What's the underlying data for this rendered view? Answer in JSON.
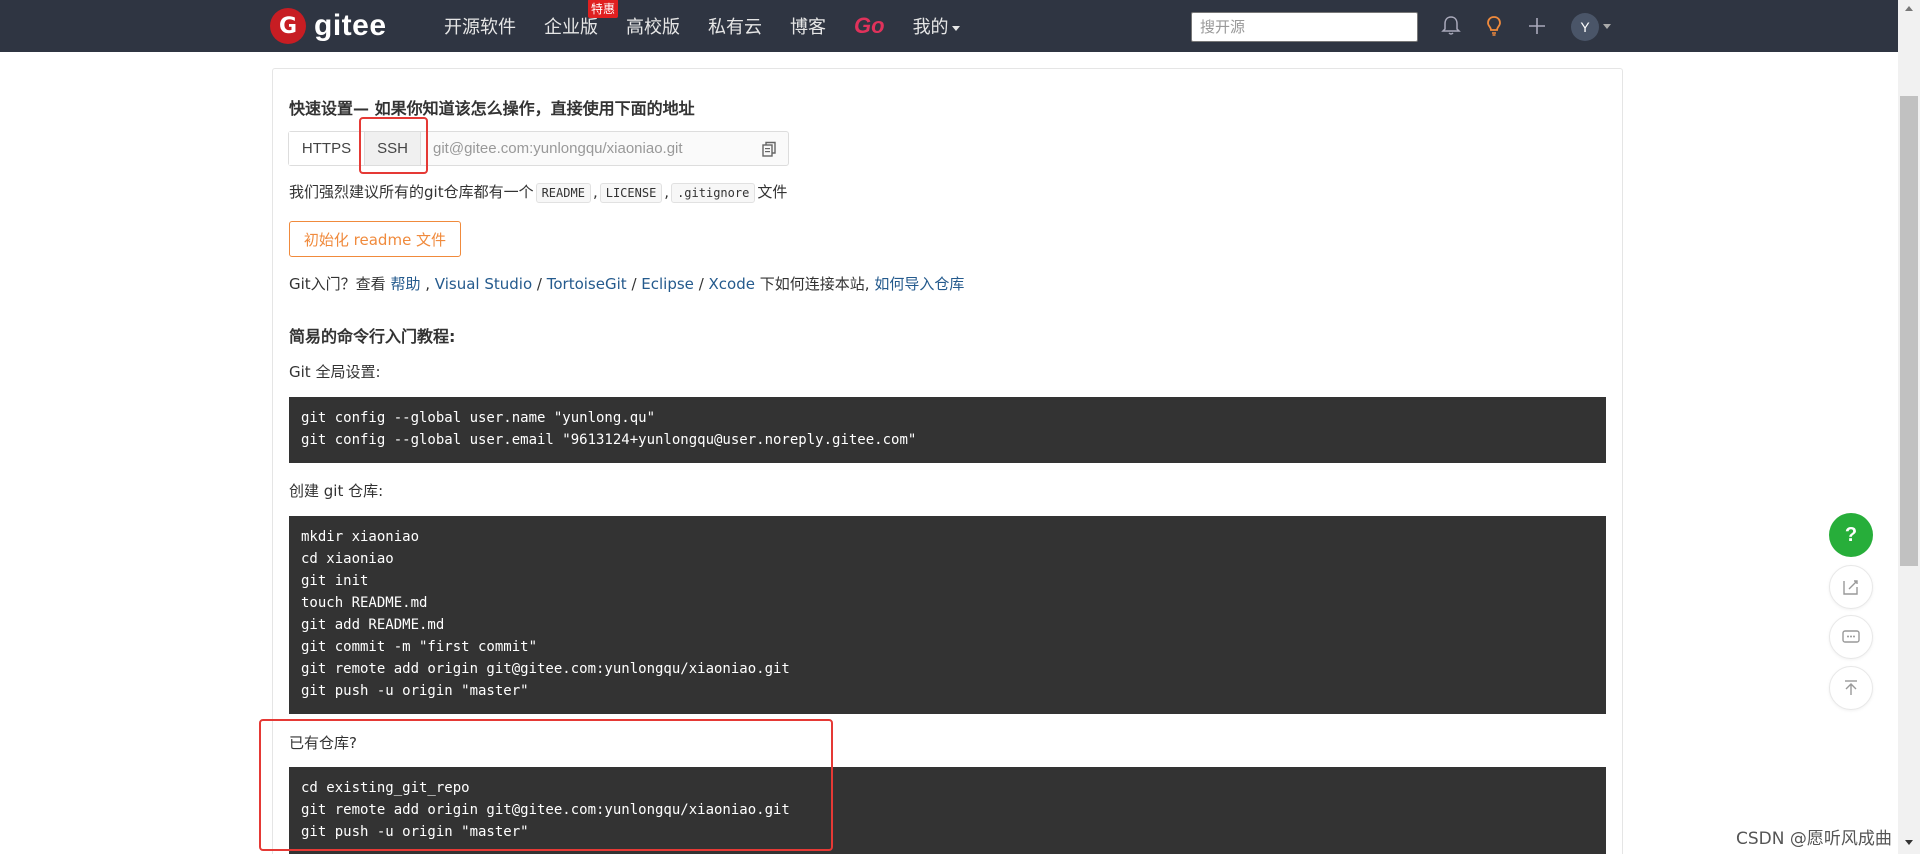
{
  "nav": {
    "logo_text": "gitee",
    "logo_mark": "G",
    "items": [
      "开源软件",
      "企业版",
      "高校版",
      "私有云",
      "博客",
      "Go",
      "我的"
    ],
    "enterprise_badge": "特惠",
    "search_placeholder": "搜开源",
    "avatar_letter": "Y"
  },
  "quick_setup": {
    "title": "快速设置— 如果你知道该怎么操作，直接使用下面的地址",
    "tab_https": "HTTPS",
    "tab_ssh": "SSH",
    "clone_url": "git@gitee.com:yunlongqu/xiaoniao.git",
    "recommend_prefix": "我们强烈建议所有的git仓库都有一个",
    "file_readme": "README",
    "file_license": "LICENSE",
    "file_gitignore": ".gitignore",
    "recommend_suffix": "文件",
    "sep": ",",
    "init_button": "初始化 readme 文件",
    "help_prefix": "Git入门？查看",
    "help_link": "帮助",
    "link_vs": "Visual Studio",
    "link_tortoise": "TortoiseGit",
    "link_eclipse": "Eclipse",
    "link_xcode": "Xcode",
    "slash": "/",
    "help_middle": "下如何连接本站,",
    "import_link": "如何导入仓库"
  },
  "tutorial": {
    "title": "简易的命令行入门教程:",
    "global_label": "Git 全局设置:",
    "global_code": "git config --global user.name \"yunlong.qu\"\ngit config --global user.email \"9613124+yunlongqu@user.noreply.gitee.com\"",
    "create_label": "创建 git 仓库:",
    "create_code": "mkdir xiaoniao\ncd xiaoniao\ngit init\ntouch README.md\ngit add README.md\ngit commit -m \"first commit\"\ngit remote add origin git@gitee.com:yunlongqu/xiaoniao.git\ngit push -u origin \"master\"",
    "existing_label": "已有仓库?",
    "existing_code": "cd existing_git_repo\ngit remote add origin git@gitee.com:yunlongqu/xiaoniao.git\ngit push -u origin \"master\""
  },
  "floating": {
    "help": "?"
  },
  "watermark": "CSDN @愿听风成曲",
  "icons": {
    "bell": "bell-icon",
    "bulb": "lightbulb-icon",
    "plus": "plus-icon",
    "copy": "copy-icon",
    "edit": "edit-icon",
    "comment": "comment-icon",
    "top": "back-to-top-icon"
  },
  "colors": {
    "nav_bg": "#2f3542",
    "brand_red": "#c71d23",
    "go_pink": "#e0325b",
    "init_orange": "#f08a3c",
    "link_blue": "#245a8d",
    "code_bg": "#333333",
    "help_green": "#27ae3a",
    "highlight_red": "#e53935"
  }
}
